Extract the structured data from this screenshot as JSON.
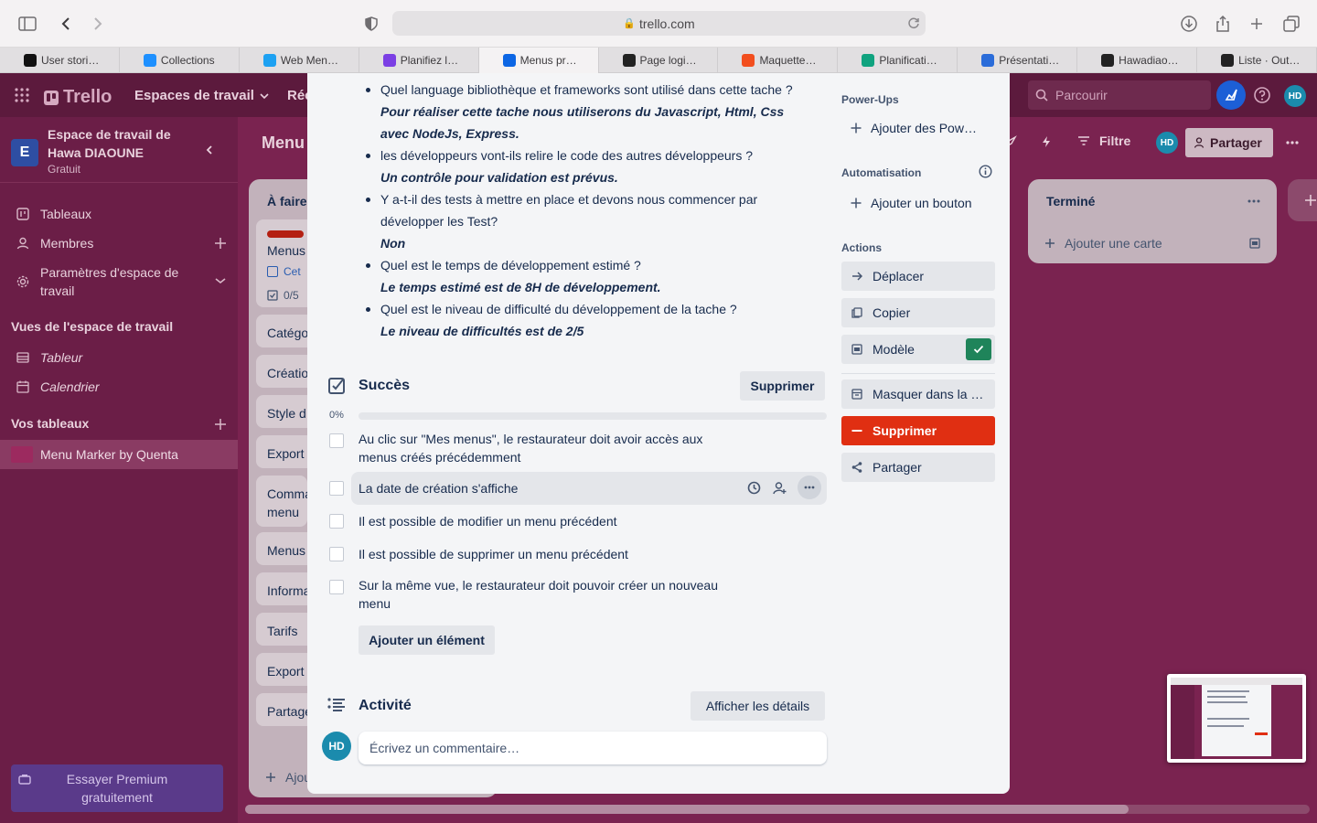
{
  "browser": {
    "url": "trello.com",
    "tabs": [
      {
        "title": "User stori…",
        "color": "#111111"
      },
      {
        "title": "Collections",
        "color": "#1e90ff"
      },
      {
        "title": "Web Men…",
        "color": "#1da1f2"
      },
      {
        "title": "Planifiez l…",
        "color": "#7b3fe4"
      },
      {
        "title": "Menus pr…",
        "color": "#0c66e4"
      },
      {
        "title": "Page logi…",
        "color": "#222222"
      },
      {
        "title": "Maquette…",
        "color": "#f24e1e"
      },
      {
        "title": "Planificati…",
        "color": "#10a37f"
      },
      {
        "title": "Présentati…",
        "color": "#2b6cd9"
      },
      {
        "title": "Hawadiao…",
        "color": "#222222"
      },
      {
        "title": "Liste · Out…",
        "color": "#222222"
      }
    ]
  },
  "header": {
    "logo": "Trello",
    "workspaces": "Espaces de travail",
    "recent": "Réc",
    "search_placeholder": "Parcourir",
    "avatar": "HD"
  },
  "sidebar": {
    "workspace_letter": "E",
    "workspace_name": "Espace de travail de Hawa DIAOUNE",
    "workspace_plan": "Gratuit",
    "items": [
      "Tableaux",
      "Membres",
      "Paramètres d'espace de travail"
    ],
    "views_title": "Vues de l'espace de travail",
    "views": [
      "Tableur",
      "Calendrier"
    ],
    "boards_title": "Vos tableaux",
    "boards": [
      "Menu Marker by Quenta"
    ],
    "premium": "Essayer Premium gratuitement"
  },
  "board": {
    "title": "Menu",
    "filter": "Filtre",
    "share": "Partager",
    "avatar": "HD",
    "list_title": "À faire",
    "list_cards": [
      "Menus",
      "Catégo",
      "Créatio",
      "Style d",
      "Export",
      "Comma menu",
      "Menus",
      "Informa",
      "Tarifs",
      "Export",
      "Partage"
    ],
    "card_meta": [
      "Cet",
      "0/5"
    ],
    "list_add": "Ajou",
    "done_title": "Terminé",
    "done_add": "Ajouter une carte"
  },
  "modal": {
    "description": [
      {
        "q": "Quel language bibliothèque et frameworks sont utilisé dans cette tache ?",
        "a": "Pour réaliser cette tache nous utiliserons du Javascript, Html, Css avec NodeJs, Express."
      },
      {
        "q": "les développeurs vont-ils relire le code des autres développeurs ?",
        "a": "Un contrôle pour validation est prévus."
      },
      {
        "q": "Y a-t-il des tests à mettre en place et devons nous commencer par développer les Test?",
        "a": "Non"
      },
      {
        "q": "Quel est le temps de développement estimé ?",
        "a": "Le temps estimé est de 8H de développement."
      },
      {
        "q": "Quel est le niveau de difficulté du développement de la tache ?",
        "a": "Le niveau de difficultés est de 2/5"
      }
    ],
    "checklist": {
      "title": "Succès",
      "delete": "Supprimer",
      "percent": "0%",
      "progress": 0,
      "items": [
        "Au clic sur \"Mes menus\", le restaurateur doit avoir accès aux menus créés précédemment",
        "La date de création s'affiche",
        "Il est possible de modifier un menu précédent",
        "Il est possible de supprimer un menu précédent",
        "Sur la même vue, le restaurateur doit pouvoir créer un nouveau menu"
      ],
      "add_item": "Ajouter un élément"
    },
    "activity": {
      "title": "Activité",
      "details": "Afficher les détails",
      "avatar": "HD",
      "comment_placeholder": "Écrivez un commentaire…"
    },
    "right": {
      "powerups_title": "Power-Ups",
      "add_powerups": "Ajouter des Pow…",
      "automation_title": "Automatisation",
      "add_button": "Ajouter un bouton",
      "actions_title": "Actions",
      "move": "Déplacer",
      "copy": "Copier",
      "template": "Modèle",
      "hide": "Masquer dans la …",
      "delete": "Supprimer",
      "share": "Partager"
    }
  },
  "colors": {
    "accent_red": "#e02f12",
    "template_check": "#1f845a",
    "avatar_bg": "#1b8bad"
  }
}
